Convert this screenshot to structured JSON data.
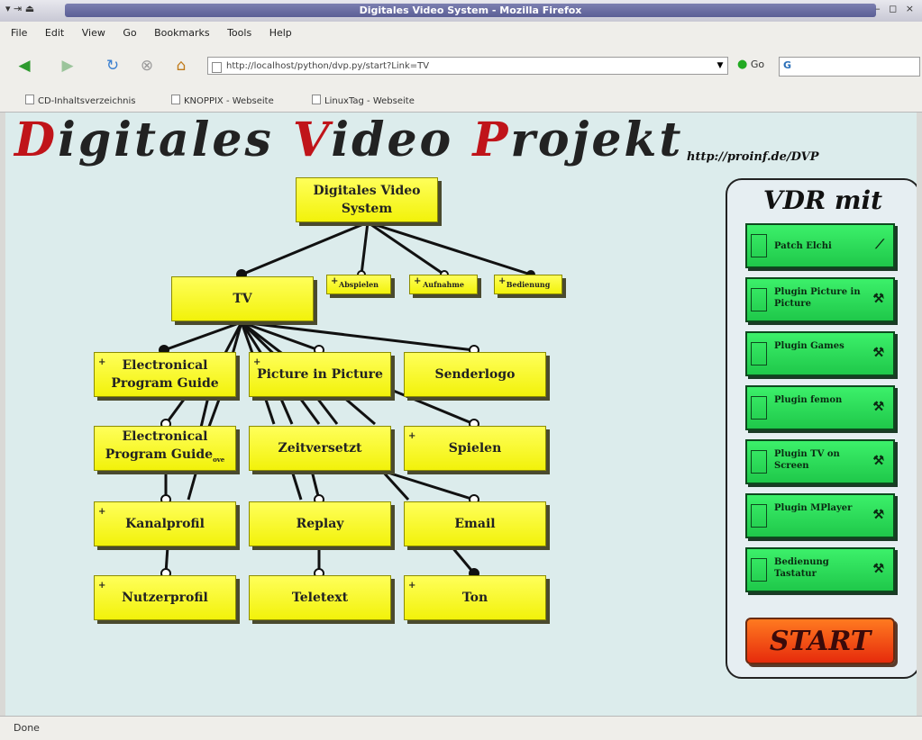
{
  "window": {
    "title": "Digitales Video System - Mozilla Firefox",
    "controls": "– ◻ ×"
  },
  "menu": [
    "File",
    "Edit",
    "View",
    "Go",
    "Bookmarks",
    "Tools",
    "Help"
  ],
  "navbar": {
    "url": "http://localhost/python/dvp.py/start?Link=TV",
    "go_label": "Go",
    "search_engine_icon": "google-icon"
  },
  "bookmarks": [
    "CD-Inhaltsverzeichnis",
    "KNOPPIX - Webseite",
    "LinuxTag - Webseite"
  ],
  "status": "Done",
  "header": {
    "logo_parts": [
      "D",
      "igitales ",
      "V",
      "ideo ",
      "P",
      "rojekt"
    ],
    "url": "http://proinf.de/DVP"
  },
  "diagram": {
    "root": "Digitales Video System",
    "top_items": [
      "Abspielen",
      "Aufnahme",
      "Bedienung"
    ],
    "tv": "TV",
    "nodes": {
      "epg": "Electronical Program Guide",
      "pip": "Picture in Picture",
      "senderlogo": "Senderlogo",
      "epg2": "Electronical Program Guide",
      "epg2_suffix": "ove",
      "zeitversetzt": "Zeitversetzt",
      "spielen": "Spielen",
      "kanalprofil": "Kanalprofil",
      "replay": "Replay",
      "email": "Email",
      "nutzerprofil": "Nutzerprofil",
      "teletext": "Teletext",
      "ton": "Ton"
    },
    "plus_marker": "+"
  },
  "sidebar": {
    "title": "VDR mit",
    "plugins": [
      "Patch Elchi",
      "Plugin Picture in Picture",
      "Plugin Games",
      "Plugin femon",
      "Plugin TV on Screen",
      "Plugin MPlayer",
      "Bedienung Tastatur"
    ],
    "start_label": "START"
  },
  "colors": {
    "node_fill": "#f5f512",
    "plugin_fill": "#2ee05a",
    "start_fill": "#f04a14",
    "page_bg": "#dcecec",
    "logo_red": "#c0141a"
  }
}
